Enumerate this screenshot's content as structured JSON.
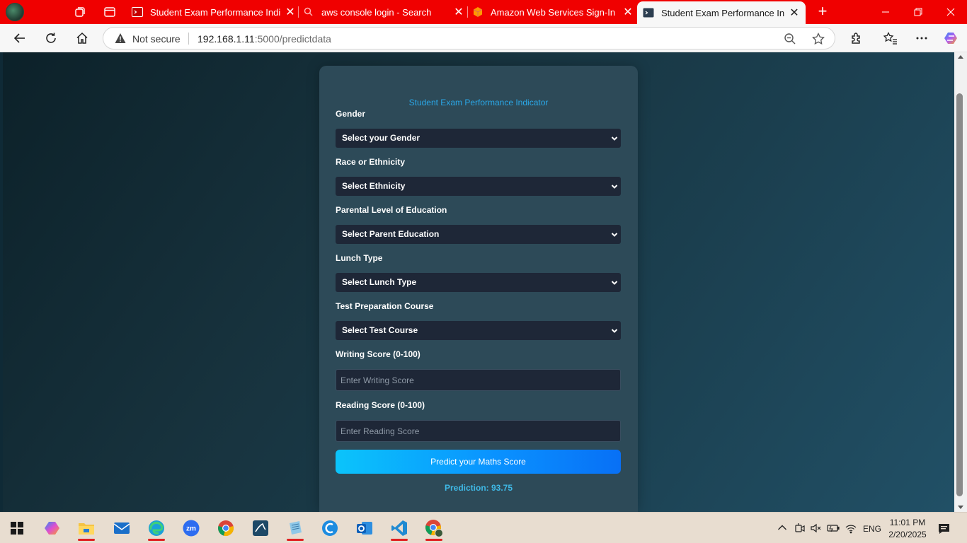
{
  "browser": {
    "tabs": [
      {
        "title": "Student Exam Performance Indica",
        "active": false,
        "favicon": "terminal-icon"
      },
      {
        "title": "aws console login - Search",
        "active": false,
        "favicon": "search-icon"
      },
      {
        "title": "Amazon Web Services Sign-In",
        "active": false,
        "favicon": "aws-cube-icon"
      },
      {
        "title": "Student Exam Performance Indica",
        "active": true,
        "favicon": "terminal-icon"
      }
    ],
    "security_label": "Not secure",
    "url_host": "192.168.1.11",
    "url_path": ":5000/predictdata"
  },
  "page": {
    "title": "Student Exam Performance Indicator",
    "fields": {
      "gender": {
        "label": "Gender",
        "selected": "Select your Gender"
      },
      "ethnicity": {
        "label": "Race or Ethnicity",
        "selected": "Select Ethnicity"
      },
      "parent_education": {
        "label": "Parental Level of Education",
        "selected": "Select Parent Education"
      },
      "lunch": {
        "label": "Lunch Type",
        "selected": "Select Lunch Type"
      },
      "test_course": {
        "label": "Test Preparation Course",
        "selected": "Select Test Course"
      },
      "writing": {
        "label": "Writing Score (0-100)",
        "placeholder": "Enter Writing Score",
        "value": ""
      },
      "reading": {
        "label": "Reading Score (0-100)",
        "placeholder": "Enter Reading Score",
        "value": ""
      }
    },
    "submit_label": "Predict your Maths Score",
    "prediction": "Prediction: 93.75"
  },
  "taskbar": {
    "apps": [
      "copilot-icon",
      "file-explorer-icon",
      "mail-icon",
      "edge-icon",
      "zoom-icon",
      "chrome-icon",
      "mysql-workbench-icon",
      "notepad-icon",
      "ccleaner-icon",
      "outlook-icon",
      "vscode-icon",
      "chrome-profile-icon"
    ],
    "language": "ENG",
    "time": "11:01 PM",
    "date": "2/20/2025"
  },
  "colors": {
    "tab_strip": "#f00000",
    "card": "#2d4a58",
    "title_accent": "#2aa8e8",
    "button_start": "#0bc4fb",
    "button_end": "#0870f6",
    "prediction_text": "#3fb9e6"
  }
}
